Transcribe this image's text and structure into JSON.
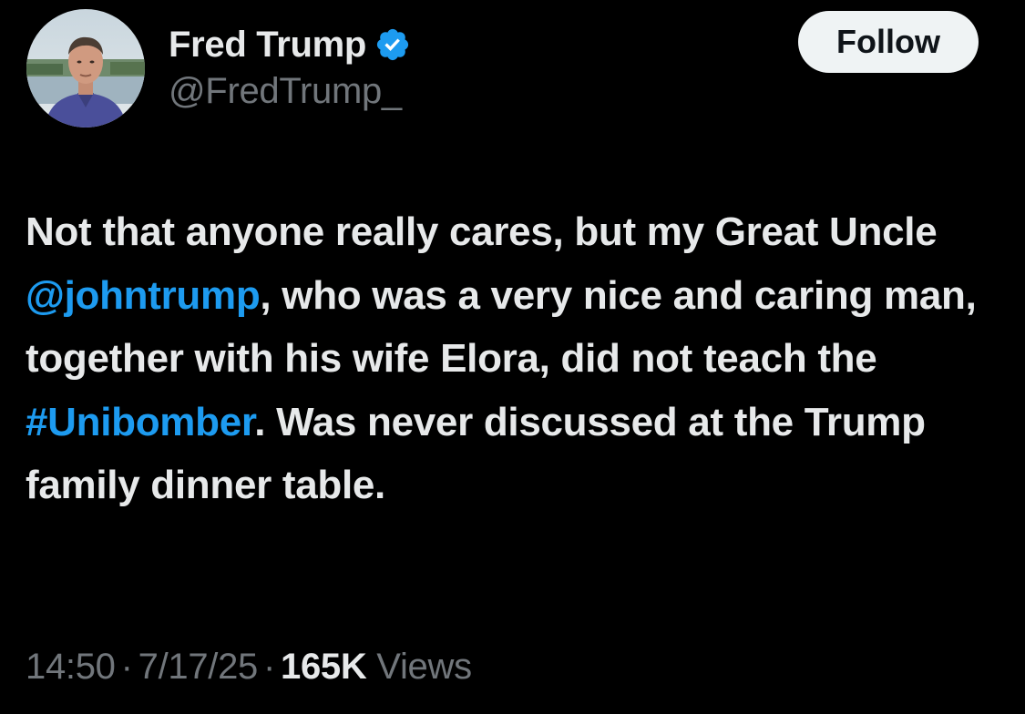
{
  "author": {
    "display_name": "Fred Trump",
    "handle": "@FredTrump_",
    "verified": true,
    "avatar_icon": "profile-photo"
  },
  "follow_button": {
    "label": "Follow"
  },
  "tweet": {
    "segments": [
      {
        "text": "Not that anyone really cares, but my Great Uncle ",
        "type": "text"
      },
      {
        "text": "@johntrump",
        "type": "mention"
      },
      {
        "text": ", who was a very nice and caring man, together with his wife Elora, did not teach the ",
        "type": "text"
      },
      {
        "text": "#Unibomber",
        "type": "hashtag"
      },
      {
        "text": ". Was never discussed at the Trump family dinner table.",
        "type": "text"
      }
    ]
  },
  "meta": {
    "time": "14:50",
    "separator": "·",
    "date": "7/17/25",
    "views_count": "165K",
    "views_label": "Views"
  },
  "colors": {
    "background": "#000000",
    "text_primary": "#e7e9ea",
    "text_secondary": "#71767b",
    "accent": "#1d9bf0",
    "button_bg": "#eff3f4"
  }
}
